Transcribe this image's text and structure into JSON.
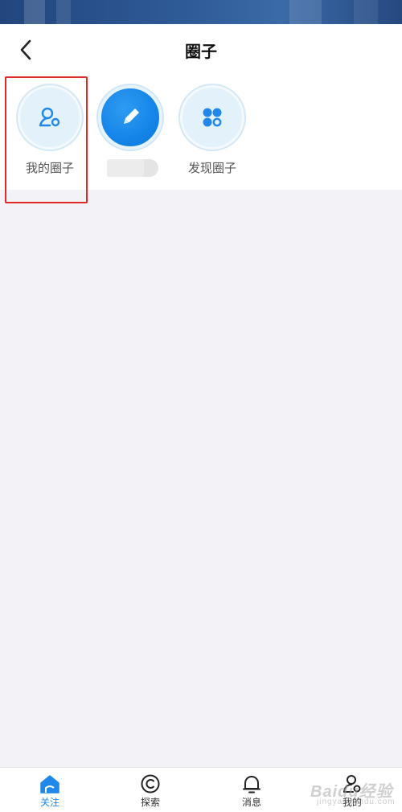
{
  "header": {
    "title": "圈子"
  },
  "shortcuts": [
    {
      "label": "我的圈子",
      "icon": "user-circle-icon"
    },
    {
      "label": "",
      "icon": "edit-pencil-icon"
    },
    {
      "label": "发现圈子",
      "icon": "discover-circles-icon"
    }
  ],
  "tabbar": {
    "items": [
      {
        "label": "关注",
        "icon": "home-icon",
        "active": true
      },
      {
        "label": "探索",
        "icon": "explore-icon",
        "active": false
      },
      {
        "label": "消息",
        "icon": "bell-icon",
        "active": false
      },
      {
        "label": "我的",
        "icon": "profile-icon",
        "active": false
      }
    ]
  },
  "watermark": {
    "text": "Baidu经验",
    "subtext": "jingyan.baidu.com"
  },
  "colors": {
    "accent": "#1f88e8",
    "highlight": "#e02a2a",
    "background": "#f2f2f7"
  }
}
